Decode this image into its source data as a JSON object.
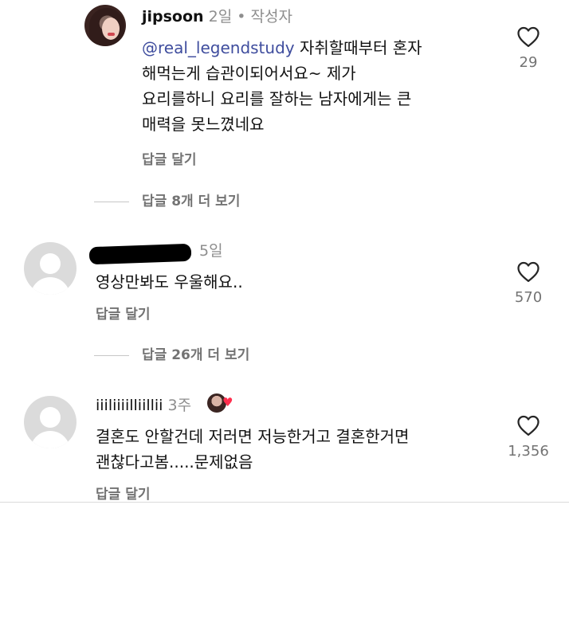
{
  "comments": [
    {
      "username": "jipsoon",
      "time": "2일",
      "separator": "•",
      "author_tag": "작성자",
      "mention": "@real_legendstudy",
      "text_lines": [
        " 자취할때부터 혼자",
        "해먹는게 습관이되어서요~ 제가",
        "요리를하니 요리를 잘하는 남자에게는 큰",
        "매력을 못느꼈네요"
      ],
      "reply_label": "답글 달기",
      "like_count": "29",
      "view_replies": "답글 8개 더 보기"
    },
    {
      "username": "",
      "time": "5일",
      "text_lines": [
        "영상만봐도 우울해요.."
      ],
      "reply_label": "답글 달기",
      "like_count": "570",
      "view_replies": "답글 26개 더 보기"
    },
    {
      "username": "iiiliiiilliillii",
      "time": "3주",
      "text_lines": [
        "결혼도 안할건데 저러면 저능한거고 결혼한거면",
        "괜찮다고봄.....문제없음"
      ],
      "reply_label": "답글 달기",
      "like_count": "1,356"
    }
  ],
  "icons": {
    "like": "heart-outline-icon",
    "liked_by_author": "heart-filled-icon"
  },
  "colors": {
    "mention": "#3f4d9e",
    "secondary_text": "#8e8e8e",
    "heart": "#ff2f4e"
  }
}
